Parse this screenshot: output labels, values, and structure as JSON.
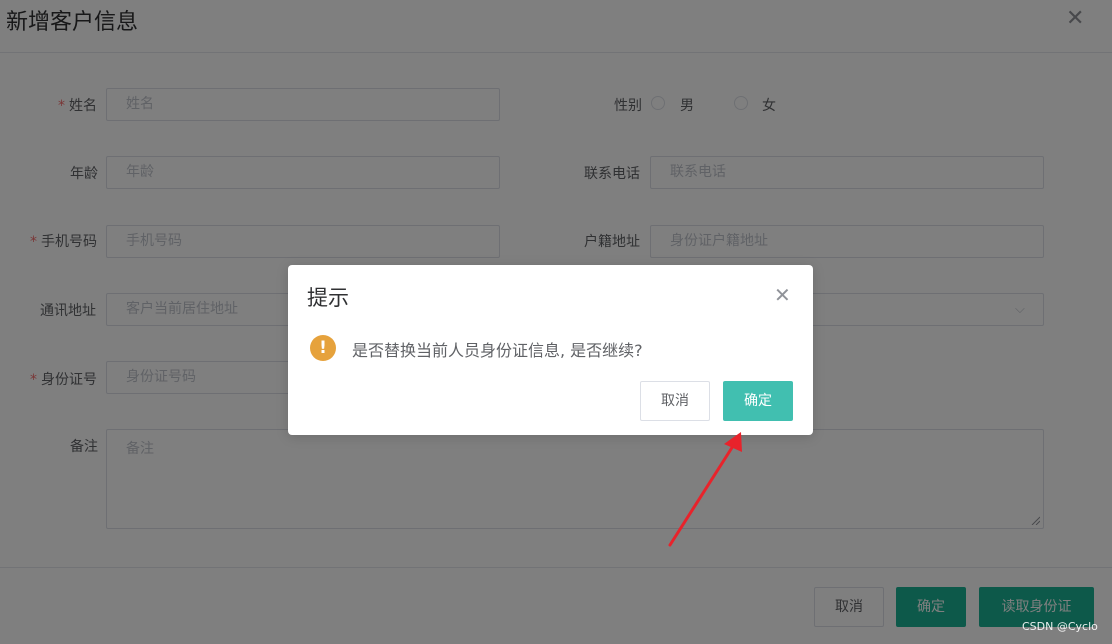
{
  "dialog": {
    "title": "新增客户信息",
    "close_icon": "close-icon"
  },
  "form": {
    "name": {
      "label": "姓名",
      "placeholder": "姓名",
      "required": true
    },
    "gender": {
      "label": "性别",
      "options": [
        "男",
        "女"
      ]
    },
    "age": {
      "label": "年龄",
      "placeholder": "年龄"
    },
    "phone_contact": {
      "label": "联系电话",
      "placeholder": "联系电话"
    },
    "mobile": {
      "label": "手机号码",
      "placeholder": "手机号码",
      "required": true
    },
    "household_address": {
      "label": "户籍地址",
      "placeholder": "身份证户籍地址"
    },
    "mailing_address": {
      "label": "通讯地址",
      "placeholder": "客户当前居住地址"
    },
    "id_number": {
      "label": "身份证号",
      "placeholder": "身份证号码",
      "required": true
    },
    "remark": {
      "label": "备注",
      "placeholder": "备注"
    },
    "required_mark": "*"
  },
  "footer": {
    "cancel_label": "取消",
    "confirm_label": "确定",
    "read_id_label": "读取身份证"
  },
  "confirm_box": {
    "title": "提示",
    "message": "是否替换当前人员身份证信息, 是否继续?",
    "warning_icon_glyph": "!",
    "cancel_label": "取消",
    "ok_label": "确定"
  },
  "colors": {
    "primary": "#1ab394",
    "confirm_ok": "#41bfb0",
    "warning": "#e6a23c",
    "required": "#f56c6c",
    "annotation_arrow": "#e8232b"
  },
  "watermark": "CSDN @Cyclo"
}
